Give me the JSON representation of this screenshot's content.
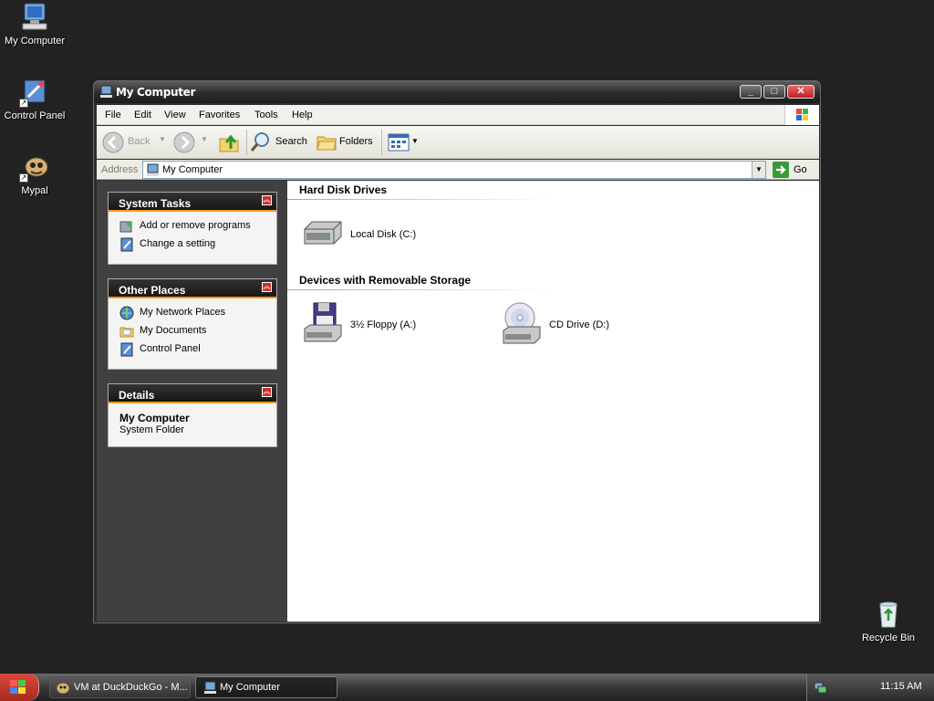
{
  "desktop": {
    "icons": [
      {
        "label": "My Computer"
      },
      {
        "label": "Control Panel"
      },
      {
        "label": "Mypal"
      },
      {
        "label": "Recycle Bin"
      }
    ]
  },
  "window": {
    "title": "My Computer",
    "menu": [
      "File",
      "Edit",
      "View",
      "Favorites",
      "Tools",
      "Help"
    ],
    "toolbar": {
      "back": "Back",
      "search": "Search",
      "folders": "Folders"
    },
    "address": {
      "label": "Address",
      "value": "My Computer",
      "go": "Go"
    }
  },
  "sidepane": {
    "system_tasks": {
      "title": "System Tasks",
      "items": [
        "Add or remove programs",
        "Change a setting"
      ]
    },
    "other_places": {
      "title": "Other Places",
      "items": [
        "My Network Places",
        "My Documents",
        "Control Panel"
      ]
    },
    "details": {
      "title": "Details",
      "name": "My Computer",
      "type": "System Folder"
    }
  },
  "content": {
    "sections": [
      {
        "title": "Hard Disk Drives",
        "items": [
          {
            "label": "Local Disk (C:)",
            "icon": "hard-disk-icon"
          }
        ]
      },
      {
        "title": "Devices with Removable Storage",
        "items": [
          {
            "label": "3½ Floppy (A:)",
            "icon": "floppy-drive-icon"
          },
          {
            "label": "CD Drive (D:)",
            "icon": "cd-drive-icon"
          }
        ]
      }
    ]
  },
  "taskbar": {
    "tasks": [
      {
        "label": "VM at DuckDuckGo - M..."
      },
      {
        "label": "My Computer"
      }
    ],
    "clock": "11:15 AM"
  },
  "colors": {
    "accent": "#ff9a1a",
    "desktop": "#222222",
    "panel_bg": "#404040"
  }
}
